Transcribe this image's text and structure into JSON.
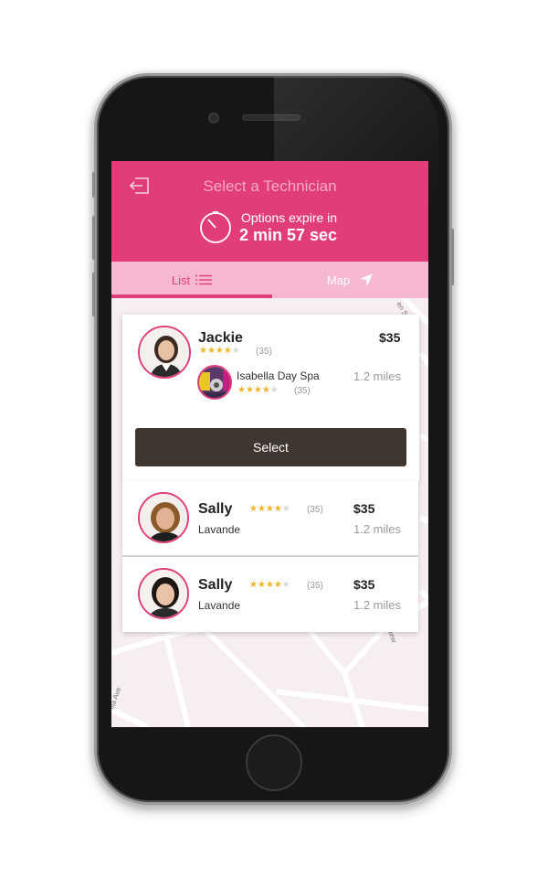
{
  "header": {
    "title": "Select a Technician",
    "expire_label": "Options expire in",
    "expire_time": "2 min 57 sec"
  },
  "tabs": [
    {
      "label": "List",
      "active": true
    },
    {
      "label": "Map",
      "active": false
    }
  ],
  "map": {
    "streets": [
      "en S",
      "New",
      "illa Ave"
    ]
  },
  "selected": {
    "name": "Jackie",
    "rating_stars": 4,
    "rating_count": "(35)",
    "price": "$35",
    "salon": "Isabella Day Spa",
    "salon_rating_stars": 4,
    "salon_rating_count": "(35)",
    "distance": "1.2 miles",
    "select_label": "Select"
  },
  "technicians": [
    {
      "name": "Sally",
      "salon": "Lavande",
      "rating_stars": 4,
      "rating_count": "(35)",
      "price": "$35",
      "distance": "1.2 miles"
    },
    {
      "name": "Sally",
      "salon": "Lavande",
      "rating_stars": 4,
      "rating_count": "(35)",
      "price": "$35",
      "distance": "1.2 miles"
    }
  ],
  "colors": {
    "brand": "#e23d7b",
    "tab_bar": "#f6b8d1",
    "button": "#3f3630",
    "star": "#f0b429"
  },
  "icons": {
    "back": "exit-arrow-icon",
    "timer": "stopwatch-icon",
    "list": "list-icon",
    "map": "navigation-arrow-icon"
  }
}
